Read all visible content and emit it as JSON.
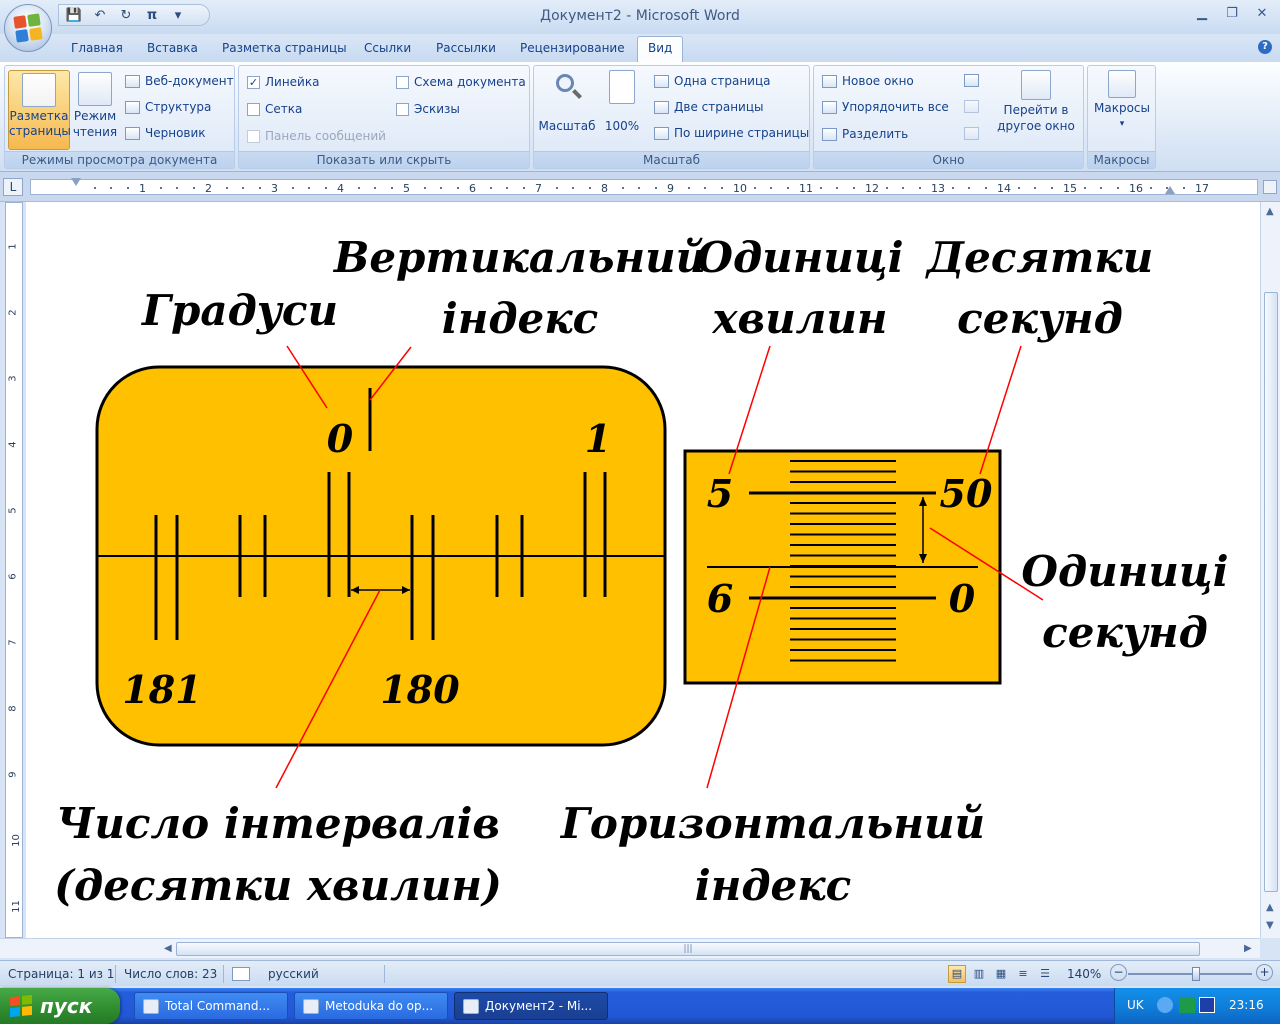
{
  "window": {
    "title": "Документ2 - Microsoft Word",
    "minimize": "▁",
    "maximize": "❐",
    "close": "✕"
  },
  "quick_access": {
    "save": "💾",
    "undo": "↶",
    "redo": "↻",
    "pi": "π",
    "more": "▾"
  },
  "tabs": [
    "Главная",
    "Вставка",
    "Разметка страницы",
    "Ссылки",
    "Рассылки",
    "Рецензирование",
    "Вид"
  ],
  "active_tab": "Вид",
  "ribbon": {
    "views": {
      "label": "Режимы просмотра документа",
      "page_layout": "Разметка страницы",
      "reading_line1": "Режим",
      "reading_line2": "чтения",
      "web": "Веб-документ",
      "outline": "Структура",
      "draft": "Черновик"
    },
    "show_hide": {
      "label": "Показать или скрыть",
      "ruler": "Линейка",
      "ruler_checked": "✓",
      "grid": "Сетка",
      "message_bar": "Панель сообщений",
      "doc_map": "Схема документа",
      "thumbnails": "Эскизы"
    },
    "zoom": {
      "label": "Масштаб",
      "zoom": "Масштаб",
      "percent": "100%",
      "one_page": "Одна страница",
      "two_pages": "Две страницы",
      "page_width": "По ширине страницы"
    },
    "window": {
      "label": "Окно",
      "new_window": "Новое окно",
      "arrange_all": "Упорядочить все",
      "split": "Разделить",
      "switch_line1": "Перейти в",
      "switch_line2": "другое окно"
    },
    "macros": {
      "label": "Макросы",
      "button": "Макросы"
    }
  },
  "ruler": {
    "corner": "L",
    "h_numbers": [
      "1",
      "2",
      "3",
      "4",
      "5",
      "6",
      "7",
      "8",
      "9",
      "10",
      "11",
      "12",
      "13",
      "14",
      "15",
      "16",
      "17"
    ],
    "v_numbers": [
      "1",
      "2",
      "3",
      "4",
      "5",
      "6",
      "7",
      "8",
      "9",
      "10",
      "11"
    ]
  },
  "diagram": {
    "degrees": "Градуси",
    "vertical_index_1": "Вертикальний",
    "vertical_index_2": "індекс",
    "minute_units_1": "Одиниці",
    "minute_units_2": "хвилин",
    "second_tens_1": "Десятки",
    "second_tens_2": "секунд",
    "second_units_1": "Одиниці",
    "second_units_2": "секунд",
    "interval_count_1": "Число інтервалів",
    "interval_count_2": "(десятки хвилин)",
    "horizontal_index_1": "Горизонтальний",
    "horizontal_index_2": "індекс",
    "scale_top_left": "0",
    "scale_top_right": "1",
    "scale_bottom_left": "181",
    "scale_bottom_right": "180",
    "micro_top_left": "5",
    "micro_top_right": "50",
    "micro_bottom_left": "6",
    "micro_bottom_right": "0",
    "colors": {
      "fill": "#ffc000",
      "leader": "#ff0000"
    }
  },
  "statusbar": {
    "page": "Страница: 1 из 1",
    "words": "Число слов: 23",
    "language": "русский",
    "zoom": "140%",
    "zoom_minus": "−",
    "zoom_plus": "+",
    "zoom_level_percent": 140
  },
  "taskbar": {
    "start": "пуск",
    "tasks": [
      "Total Command...",
      "Metoduka do op...",
      "Документ2 - Mi..."
    ],
    "lang": "UK",
    "clock": "23:16"
  }
}
